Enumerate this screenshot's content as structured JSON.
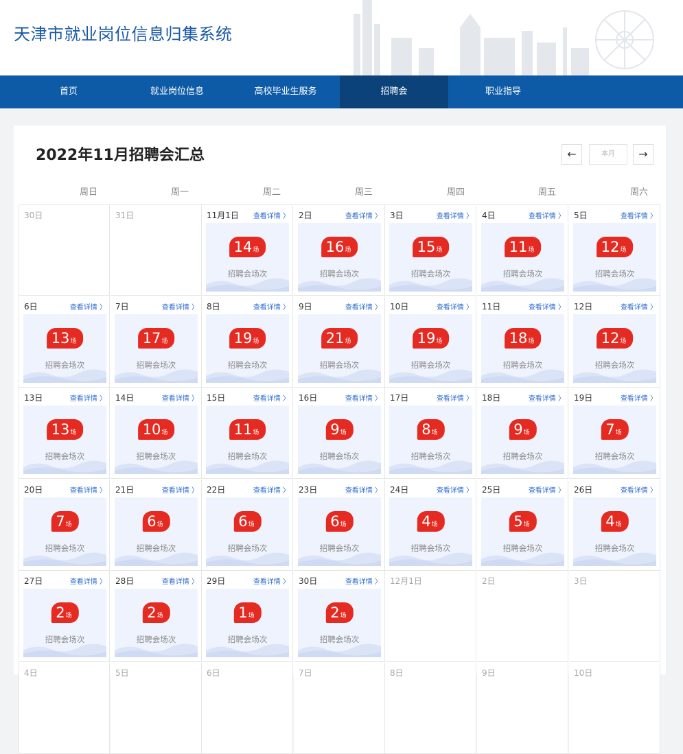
{
  "header": {
    "title": "天津市就业岗位信息归集系统"
  },
  "nav": [
    {
      "label": "首页",
      "active": false
    },
    {
      "label": "就业岗位信息",
      "active": false
    },
    {
      "label": "高校毕业生服务",
      "active": false
    },
    {
      "label": "招聘会",
      "active": true
    },
    {
      "label": "职业指导",
      "active": false
    }
  ],
  "calendar": {
    "title": "2022年11月招聘会汇总",
    "this_month_label": "本月",
    "prev_icon": "arrow-left-icon",
    "next_icon": "arrow-right-icon",
    "weekdays": [
      "周日",
      "周一",
      "周二",
      "周三",
      "周四",
      "周五",
      "周六"
    ],
    "detail_label": "查看详情 〉",
    "count_unit": "场",
    "count_caption": "招聘会场次",
    "colors": {
      "badge": "#e52a22",
      "card": "#eef3fd",
      "link": "#2e6cd1",
      "nav": "#0d5ba6",
      "nav_active": "#0b427a"
    },
    "days": [
      {
        "label": "30日",
        "in_month": false,
        "count": null
      },
      {
        "label": "31日",
        "in_month": false,
        "count": null
      },
      {
        "label": "11月1日",
        "in_month": true,
        "count": "14"
      },
      {
        "label": "2日",
        "in_month": true,
        "count": "16"
      },
      {
        "label": "3日",
        "in_month": true,
        "count": "15"
      },
      {
        "label": "4日",
        "in_month": true,
        "count": "11"
      },
      {
        "label": "5日",
        "in_month": true,
        "count": "12"
      },
      {
        "label": "6日",
        "in_month": true,
        "count": "13"
      },
      {
        "label": "7日",
        "in_month": true,
        "count": "17"
      },
      {
        "label": "8日",
        "in_month": true,
        "count": "19"
      },
      {
        "label": "9日",
        "in_month": true,
        "count": "21"
      },
      {
        "label": "10日",
        "in_month": true,
        "count": "19"
      },
      {
        "label": "11日",
        "in_month": true,
        "count": "18"
      },
      {
        "label": "12日",
        "in_month": true,
        "count": "12"
      },
      {
        "label": "13日",
        "in_month": true,
        "count": "13"
      },
      {
        "label": "14日",
        "in_month": true,
        "count": "10"
      },
      {
        "label": "15日",
        "in_month": true,
        "count": "11"
      },
      {
        "label": "16日",
        "in_month": true,
        "count": "9"
      },
      {
        "label": "17日",
        "in_month": true,
        "count": "8"
      },
      {
        "label": "18日",
        "in_month": true,
        "count": "9"
      },
      {
        "label": "19日",
        "in_month": true,
        "count": "7"
      },
      {
        "label": "20日",
        "in_month": true,
        "count": "7"
      },
      {
        "label": "21日",
        "in_month": true,
        "count": "6"
      },
      {
        "label": "22日",
        "in_month": true,
        "count": "6"
      },
      {
        "label": "23日",
        "in_month": true,
        "count": "6"
      },
      {
        "label": "24日",
        "in_month": true,
        "count": "4"
      },
      {
        "label": "25日",
        "in_month": true,
        "count": "5"
      },
      {
        "label": "26日",
        "in_month": true,
        "count": "4"
      },
      {
        "label": "27日",
        "in_month": true,
        "count": "2"
      },
      {
        "label": "28日",
        "in_month": true,
        "count": "2"
      },
      {
        "label": "29日",
        "in_month": true,
        "count": "1"
      },
      {
        "label": "30日",
        "in_month": true,
        "count": "2"
      },
      {
        "label": "12月1日",
        "in_month": false,
        "count": null
      },
      {
        "label": "2日",
        "in_month": false,
        "count": null
      },
      {
        "label": "3日",
        "in_month": false,
        "count": null
      },
      {
        "label": "4日",
        "in_month": false,
        "count": null
      },
      {
        "label": "5日",
        "in_month": false,
        "count": null
      },
      {
        "label": "6日",
        "in_month": false,
        "count": null
      },
      {
        "label": "7日",
        "in_month": false,
        "count": null
      },
      {
        "label": "8日",
        "in_month": false,
        "count": null
      },
      {
        "label": "9日",
        "in_month": false,
        "count": null
      },
      {
        "label": "10日",
        "in_month": false,
        "count": null
      }
    ]
  }
}
